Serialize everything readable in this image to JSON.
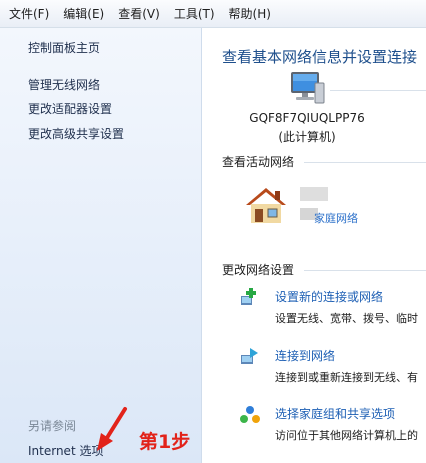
{
  "menu": [
    "文件(F)",
    "编辑(E)",
    "查看(V)",
    "工具(T)",
    "帮助(H)"
  ],
  "sidebar": {
    "home": "控制面板主页",
    "links": [
      "管理无线网络",
      "更改适配器设置",
      "更改高级共享设置"
    ],
    "see_also_heading": "另请参阅",
    "see_also_items": [
      "Internet 选项"
    ]
  },
  "main": {
    "title": "查看基本网络信息并设置连接",
    "computer_name": "GQF8F7QIUQLPP76",
    "computer_sub": "(此计算机)",
    "active_networks_label": "查看活动网络",
    "network_type": "家庭网络",
    "change_settings_label": "更改网络设置",
    "tasks": [
      {
        "link": "设置新的连接或网络",
        "desc": "设置无线、宽带、拨号、临时"
      },
      {
        "link": "连接到网络",
        "desc": "连接到或重新连接到无线、有"
      },
      {
        "link": "选择家庭组和共享选项",
        "desc": "访问位于其他网络计算机上的"
      }
    ]
  },
  "annotation": "第1步",
  "colors": {
    "link": "#1d5fb4",
    "title": "#1e4f8c",
    "annotation": "#e2231a"
  }
}
